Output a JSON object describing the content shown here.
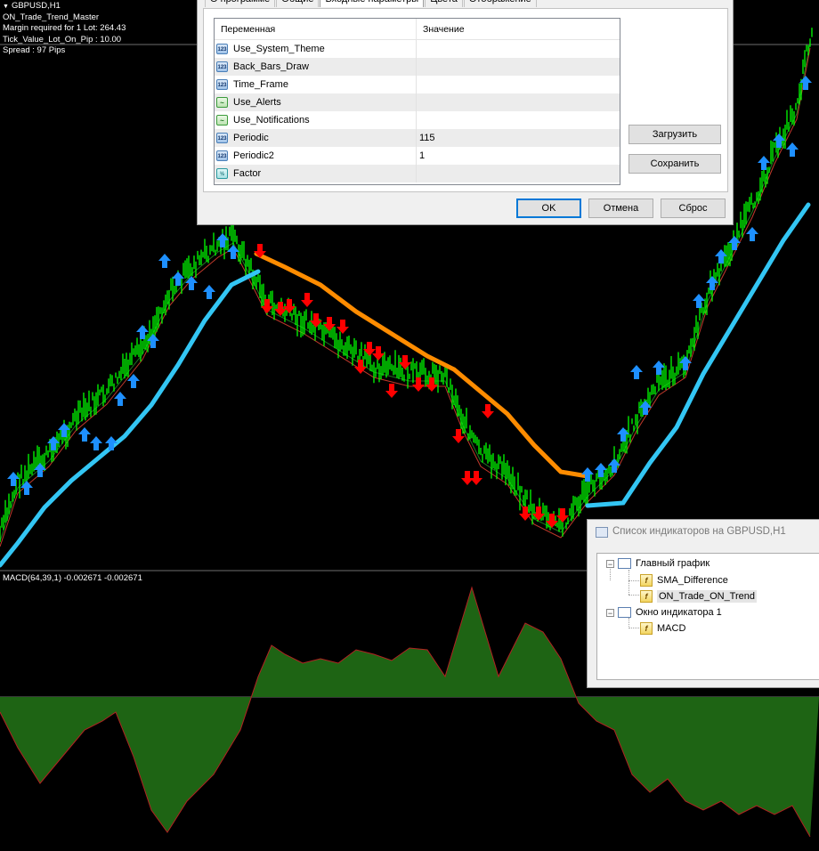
{
  "chart": {
    "symbol_header": "GBPUSD,H1",
    "expert_name": "ON_Trade_Trend_Master",
    "margin_text": "Margin required for 1 Lot: 264.43",
    "tick_value_text": "Tick_Value_Lot_On_Pip : 10.00",
    "spread_text": "Spread : 97  Pips",
    "macd_label": "MACD(64,39,1) -0.002671 -0.002671",
    "colors": {
      "background": "#000000",
      "price": "#00ff00",
      "trend_up": "#33c6f4",
      "trend_down": "#ff8c00",
      "arrow_buy": "#1e90ff",
      "arrow_sell": "#ff0000",
      "macd_fill": "#1e6414",
      "macd_line": "#b22222"
    }
  },
  "dialog": {
    "tabs": [
      "О программе",
      "Общие",
      "Входные параметры",
      "Цвета",
      "Отображение"
    ],
    "active_tab": "Входные параметры",
    "columns": [
      "Переменная",
      "Значение"
    ],
    "params": [
      {
        "name": "Use_System_Theme",
        "value": "",
        "type": "int"
      },
      {
        "name": "Back_Bars_Draw",
        "value": "",
        "type": "int"
      },
      {
        "name": "Time_Frame",
        "value": "",
        "type": "int"
      },
      {
        "name": "Use_Alerts",
        "value": "",
        "type": "bool"
      },
      {
        "name": "Use_Notifications",
        "value": "",
        "type": "bool"
      },
      {
        "name": "Periodic",
        "value": "115",
        "type": "int"
      },
      {
        "name": "Periodic2",
        "value": "1",
        "type": "int"
      },
      {
        "name": "Factor",
        "value": "",
        "type": "double"
      }
    ],
    "icon_text": {
      "int": "123",
      "bool": "~",
      "double": "½"
    },
    "load_button": "Загрузить",
    "save_button": "Сохранить",
    "ok_button": "OK",
    "cancel_button": "Отмена",
    "reset_button": "Сброс"
  },
  "indicators_window": {
    "title": "Список индикаторов на GBPUSD,H1",
    "main_chart": "Главный график",
    "main_items": [
      "SMA_Difference",
      "ON_Trade_ON_Trend"
    ],
    "subwindow": "Окно индикатора 1",
    "sub_items": [
      "MACD"
    ],
    "selected": "ON_Trade_ON_Trend"
  }
}
